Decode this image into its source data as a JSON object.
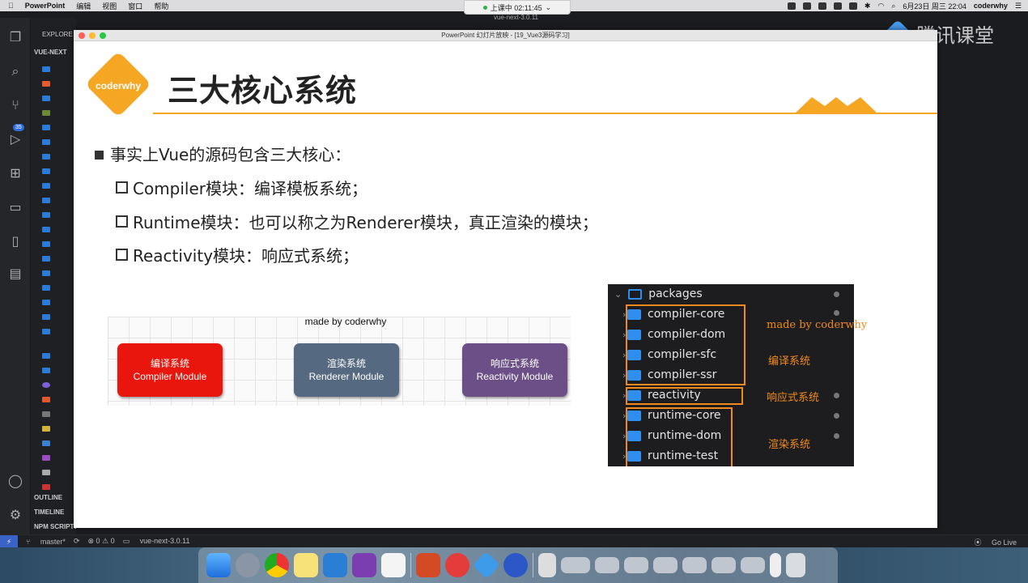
{
  "menubar": {
    "apple": "",
    "app_name": "PowerPoint",
    "menus": [
      "编辑",
      "视图",
      "窗口",
      "帮助"
    ],
    "date_time": "6月23日 周三 22:04",
    "user": "coderwhy"
  },
  "live": {
    "status": "上课中 02:11:45",
    "project": "vue-next-3.0.11"
  },
  "watermark": "腾讯课堂",
  "sidebar": {
    "header": "EXPLORE",
    "root": "VUE-NEXT",
    "sections": [
      "OUTLINE",
      "TIMELINE",
      "NPM SCRIPTS"
    ],
    "scm_badge": "35"
  },
  "statusbar": {
    "branch": "master*",
    "problems": "⊗ 0 ⚠ 0",
    "folder": "vue-next-3.0.11",
    "go_live": "Go Live"
  },
  "ppt_window": {
    "title": "PowerPoint 幻灯片放映 - [19_Vue3源码学习]"
  },
  "slide": {
    "logo": "coderwhy",
    "title": "三大核心系统",
    "bullet_main": "事实上Vue的源码包含三大核心：",
    "bullets_sub": [
      "Compiler模块：编译模板系统；",
      "Runtime模块：也可以称之为Renderer模块，真正渲染的模块；",
      "Reactivity模块：响应式系统；"
    ],
    "diagram": {
      "caption": "made by coderwhy",
      "modules": [
        {
          "cn": "编译系统",
          "en": "Compiler Module",
          "color": "#e8160c"
        },
        {
          "cn": "渲染系统",
          "en": "Renderer Module",
          "color": "#556a80"
        },
        {
          "cn": "响应式系统",
          "en": "Reactivity Module",
          "color": "#6b4f86"
        }
      ]
    },
    "packages": {
      "root": "packages",
      "items": [
        "compiler-core",
        "compiler-dom",
        "compiler-sfc",
        "compiler-ssr",
        "reactivity",
        "runtime-core",
        "runtime-dom",
        "runtime-test"
      ],
      "labels": {
        "madeby": "made by coderwhy",
        "compiler": "编译系统",
        "reactivity": "响应式系统",
        "runtime": "渲染系统"
      }
    }
  }
}
